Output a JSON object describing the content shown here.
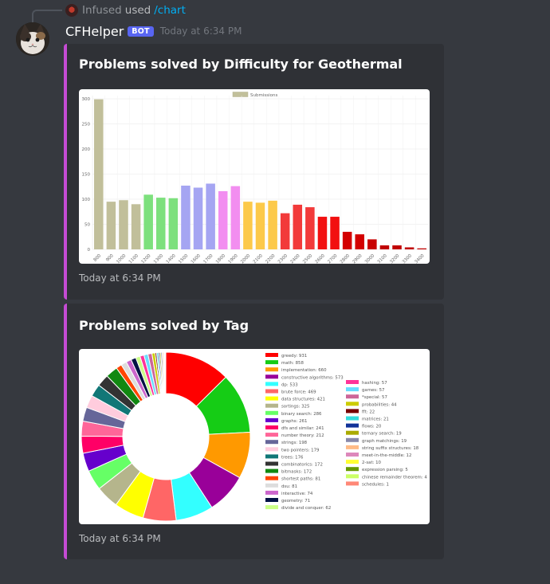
{
  "reply": {
    "name": "Infused",
    "action": "used",
    "command": "/chart"
  },
  "message": {
    "username": "CFHelper",
    "bot_tag": "BOT",
    "timestamp": "Today at 6:34 PM"
  },
  "colors": {
    "embed_accent": "#c54bd4",
    "bot_tag": "#5865f2",
    "background": "#36393f",
    "embed_bg": "#2f3136"
  },
  "embeds": [
    {
      "title": "Problems solved by Difficulty for Geothermal",
      "footer": "Today at 6:34 PM"
    },
    {
      "title": "Problems solved by Tag",
      "footer": "Today at 6:34 PM"
    }
  ],
  "chart_data": [
    {
      "type": "bar",
      "legend": "Submissions",
      "categories": [
        "800",
        "900",
        "1000",
        "1100",
        "1200",
        "1300",
        "1400",
        "1500",
        "1600",
        "1700",
        "1800",
        "1900",
        "2000",
        "2100",
        "2200",
        "2300",
        "2400",
        "2500",
        "2600",
        "2700",
        "2800",
        "2900",
        "3000",
        "3100",
        "3200",
        "3300",
        "3400"
      ],
      "values": [
        299,
        95,
        98,
        90,
        109,
        103,
        102,
        127,
        123,
        131,
        116,
        126,
        95,
        93,
        97,
        72,
        89,
        84,
        65,
        65,
        35,
        30,
        20,
        8,
        8,
        4,
        2
      ],
      "colors": [
        "#c1bf9a",
        "#c1bf9a",
        "#c1bf9a",
        "#c1bf9a",
        "#7de07d",
        "#7de07d",
        "#7de07d",
        "#a5a5f2",
        "#a5a5f2",
        "#a5a5f2",
        "#f28ef0",
        "#f28ef0",
        "#fcc94a",
        "#fcc94a",
        "#fcc94a",
        "#f23a3a",
        "#f23a3a",
        "#f23a3a",
        "#f21010",
        "#f21010",
        "#d30000",
        "#d30000",
        "#c80000",
        "#c00000",
        "#c00000",
        "#c00000",
        "#c00000"
      ],
      "yticks": [
        "0",
        "50",
        "100",
        "150",
        "200",
        "250",
        "300"
      ],
      "ylim": [
        0,
        300
      ],
      "legend_position": "top"
    },
    {
      "type": "pie",
      "slices": [
        {
          "label": "greedy: 931",
          "value": 931,
          "color": "#ff0000"
        },
        {
          "label": "math: 858",
          "value": 858,
          "color": "#15cc15"
        },
        {
          "label": "implementation: 660",
          "value": 660,
          "color": "#ff9900"
        },
        {
          "label": "constructive algorithms: 573",
          "value": 573,
          "color": "#990099"
        },
        {
          "label": "dp: 533",
          "value": 533,
          "color": "#33ffff"
        },
        {
          "label": "brute force: 469",
          "value": 469,
          "color": "#ff6666"
        },
        {
          "label": "data structures: 421",
          "value": 421,
          "color": "#ffff00"
        },
        {
          "label": "sortings: 325",
          "value": 325,
          "color": "#b5b58c"
        },
        {
          "label": "binary search: 286",
          "value": 286,
          "color": "#66ff66"
        },
        {
          "label": "graphs: 261",
          "value": 261,
          "color": "#6600cc"
        },
        {
          "label": "dfs and similar: 241",
          "value": 241,
          "color": "#ff0066"
        },
        {
          "label": "number theory: 212",
          "value": 212,
          "color": "#ff6699"
        },
        {
          "label": "strings: 198",
          "value": 198,
          "color": "#666699"
        },
        {
          "label": "two pointers: 179",
          "value": 179,
          "color": "#ffccdd"
        },
        {
          "label": "trees: 176",
          "value": 176,
          "color": "#117777"
        },
        {
          "label": "combinatorics: 172",
          "value": 172,
          "color": "#333333"
        },
        {
          "label": "bitmasks: 172",
          "value": 172,
          "color": "#118811"
        },
        {
          "label": "shortest paths: 81",
          "value": 81,
          "color": "#ff4400"
        },
        {
          "label": "dsu: 81",
          "value": 81,
          "color": "#dddddd"
        },
        {
          "label": "interactive: 74",
          "value": 74,
          "color": "#cc66cc"
        },
        {
          "label": "geometry: 71",
          "value": 71,
          "color": "#001144"
        },
        {
          "label": "divide and conquer: 62",
          "value": 62,
          "color": "#ccff88"
        },
        {
          "label": "hashing: 57",
          "value": 57,
          "color": "#ff3399"
        },
        {
          "label": "games: 57",
          "value": 57,
          "color": "#66ddff"
        },
        {
          "label": "*special: 57",
          "value": 57,
          "color": "#cc6699"
        },
        {
          "label": "probabilities: 44",
          "value": 44,
          "color": "#cccc00"
        },
        {
          "label": "fft: 22",
          "value": 22,
          "color": "#770000"
        },
        {
          "label": "matrices: 21",
          "value": 21,
          "color": "#33dddd"
        },
        {
          "label": "flows: 20",
          "value": 20,
          "color": "#113399"
        },
        {
          "label": "ternary search: 19",
          "value": 19,
          "color": "#aaaa00"
        },
        {
          "label": "graph matchings: 19",
          "value": 19,
          "color": "#8888aa"
        },
        {
          "label": "string suffix structures: 18",
          "value": 18,
          "color": "#ffbb88"
        },
        {
          "label": "meet-in-the-middle: 12",
          "value": 12,
          "color": "#dd88bb"
        },
        {
          "label": "2-sat: 10",
          "value": 10,
          "color": "#ffff33"
        },
        {
          "label": "expression parsing: 5",
          "value": 5,
          "color": "#669900"
        },
        {
          "label": "chinese remainder theorem: 4",
          "value": 4,
          "color": "#ccff66"
        },
        {
          "label": "schedules: 1",
          "value": 1,
          "color": "#ff8877"
        }
      ],
      "legend_position": "right"
    }
  ]
}
